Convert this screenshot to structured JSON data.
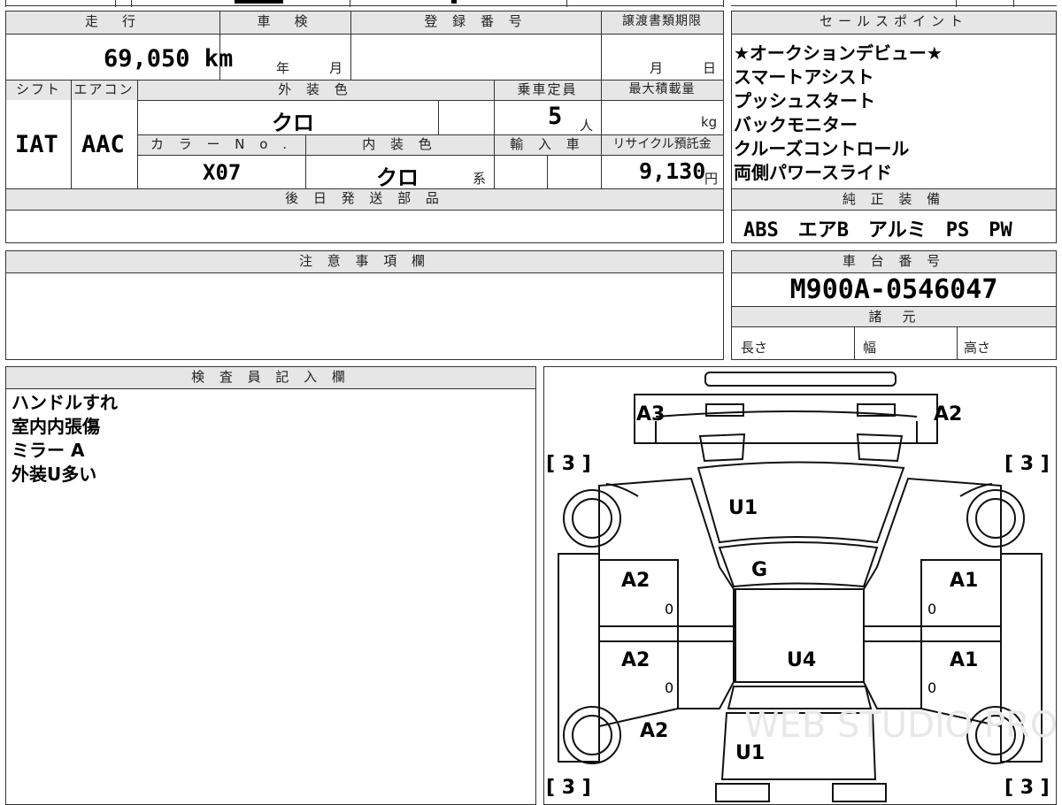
{
  "vehicle_info": {
    "mileage_label": "走　行",
    "mileage_value": "69,050 km",
    "inspection_label": "車　検",
    "inspection_year": "年",
    "inspection_month": "月",
    "registration_label": "登 録 番 号",
    "transfer_label": "譲渡書類期限",
    "transfer_month": "月",
    "transfer_day": "日",
    "shift_label": "シフト",
    "shift_value": "IAT",
    "ac_label": "エアコン",
    "ac_value": "AAC",
    "exterior_label": "外 装 色",
    "exterior_value": "クロ",
    "capacity_label": "乗車定員",
    "capacity_value": "5",
    "capacity_unit": "人",
    "load_label": "最大積載量",
    "load_unit": "kg",
    "color_no_label": "カ ラ ー N o .",
    "color_no_value": "X07",
    "interior_label": "内 装 色",
    "interior_value": "クロ",
    "interior_suffix": "系",
    "import_label": "輸 入 車",
    "recycle_label": "リサイクル預託金",
    "recycle_value": "9,130",
    "recycle_unit": "円",
    "later_parts_label": "後 日 発 送 部 品"
  },
  "sales_points": {
    "header": "セールスポイント",
    "items": [
      "★オークションデビュー★",
      "スマートアシスト",
      "プッシュスタート",
      "バックモニター",
      "クルーズコントロール",
      "両側パワースライド"
    ]
  },
  "equipment": {
    "header": "純 正 装 備",
    "value": "ABS　エアB　アルミ　PS　PW"
  },
  "caution": {
    "header": "注 意 事 項 欄"
  },
  "chassis": {
    "header": "車 台 番 号",
    "value": "M900A-0546047",
    "spec_header": "諸　元",
    "length_label": "長さ",
    "width_label": "幅",
    "height_label": "高さ"
  },
  "inspector": {
    "header": "検 査 員 記 入 欄",
    "notes": [
      "ハンドルすれ",
      "室内内張傷",
      "ミラー A",
      "外装U多い"
    ]
  },
  "diagram": {
    "marks": {
      "front_left": "A3",
      "front_right": "A2",
      "hood": "U1",
      "windshield": "G",
      "roof": "U4",
      "rear": "U1",
      "left_front_door": "A2",
      "left_rear_door": "A2",
      "left_rear_fender": "A2",
      "right_front_door": "A1",
      "right_rear_door": "A1",
      "door_small_mark": "0"
    },
    "tires": [
      "[ 3 ]",
      "[ 3 ]",
      "[ 3 ]",
      "[ 3 ]"
    ],
    "watermark": "WEB STUDIO PRO"
  }
}
